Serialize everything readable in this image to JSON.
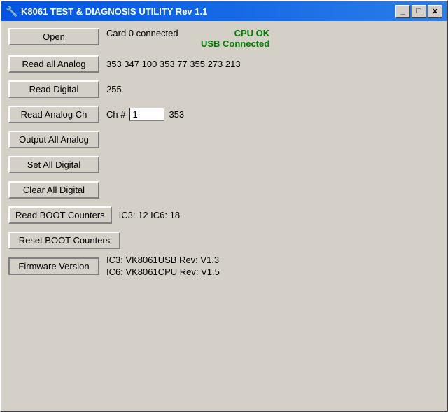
{
  "window": {
    "title": "K8061 TEST & DIAGNOSIS UTILITY Rev 1.1",
    "icon": "🔧"
  },
  "title_buttons": {
    "minimize": "_",
    "restore": "□",
    "close": "✕"
  },
  "buttons": {
    "open": "Open",
    "read_all_analog": "Read all Analog",
    "read_digital": "Read Digital",
    "read_analog_ch": "Read Analog Ch",
    "output_all_analog": "Output All Analog",
    "set_all_digital": "Set All Digital",
    "clear_all_digital": "Clear All Digital",
    "read_boot_counters": "Read BOOT Counters",
    "reset_boot_counters": "Reset BOOT Counters",
    "firmware_version": "Firmware Version"
  },
  "status": {
    "card_connected": "Card 0 connected",
    "cpu_ok": "CPU OK",
    "usb_connected": "USB Connected"
  },
  "values": {
    "analog_all": "353  347  100  353  77  355  273  213",
    "digital": "255",
    "ch_label": "Ch #",
    "ch_value": "1",
    "ch_result": "353",
    "boot_counters": "IC3: 12   IC6: 18",
    "firmware_ic3": "IC3: VK8061USB Rev: V1.3",
    "firmware_ic6": "IC6: VK8061CPU Rev: V1.5"
  }
}
